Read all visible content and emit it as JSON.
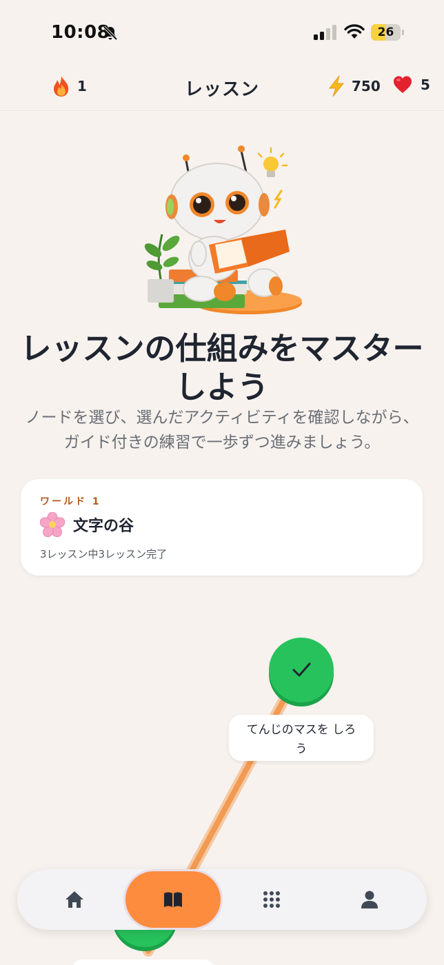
{
  "status_bar": {
    "time": "10:08",
    "battery_level": "26",
    "battery_percent": 26,
    "icons": [
      "bell-off-icon",
      "signal-icon",
      "wifi-icon"
    ]
  },
  "header": {
    "title": "レッスン",
    "streak_count": "1",
    "xp_count": "750",
    "hearts_count": "5",
    "icons": [
      "flame-icon",
      "bolt-icon",
      "heart-icon"
    ]
  },
  "hero": {
    "title": "レッスンの仕組みをマスターしよう",
    "subtitle": "ノードを選び、選んだアクティビティを確認しながら、ガイド付きの練習で一歩ずつ進みましょう。",
    "illustration": "robot-reading-book"
  },
  "world": {
    "label": "ワールド 1",
    "name": "文字の谷",
    "progress": "3レッスン中3レッスン完了",
    "icon": "cherry-blossom-icon"
  },
  "path": {
    "lessons": [
      {
        "label": "てんじのマスを しろう",
        "status": "completed"
      }
    ]
  },
  "bottom_nav": {
    "items": [
      {
        "icon": "home-icon",
        "active": false
      },
      {
        "icon": "book-icon",
        "active": true
      },
      {
        "icon": "apps-grid-icon",
        "active": false
      },
      {
        "icon": "profile-icon",
        "active": false
      }
    ]
  },
  "colors": {
    "background": "#f7f2ee",
    "accent_orange": "#fd8c3e",
    "success_green": "#27c25c",
    "world_label": "#b25a20",
    "text_primary": "#1f2530",
    "text_secondary": "#6a6e75"
  }
}
